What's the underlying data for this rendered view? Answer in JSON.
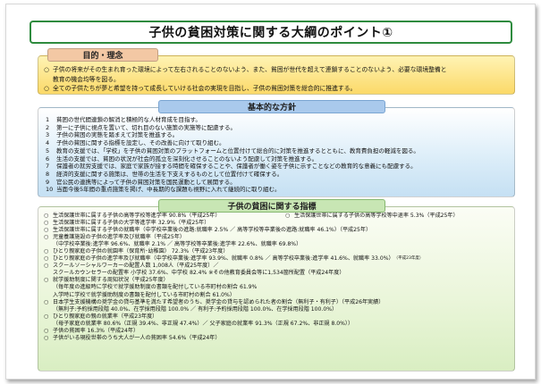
{
  "title": "子供の貧困対策に関する大綱のポイント①",
  "purpose": {
    "header": "目的・理念",
    "lines": [
      {
        "mark": "○",
        "text": "子供の将来がその生まれ育った環境によって左右されることのないよう、また、貧困が世代を超えて連鎖することのないよう、必要な環境整備と"
      },
      {
        "mark": "",
        "text": "教育の機会均等を図る。"
      },
      {
        "mark": "○",
        "text": "全ての子供たちが夢と希望を持って成長していける社会の実現を目指し、子供の貧困対策を総合的に推進する。"
      }
    ]
  },
  "policy": {
    "header": "基本的な方針",
    "items": [
      {
        "no": "1",
        "text": "貧困の世代間連鎖の解消と積極的な人材育成を目指す。"
      },
      {
        "no": "2",
        "text": "第一に子供に視点を置いて、切れ目のない施策の実施等に配慮する。"
      },
      {
        "no": "3",
        "text": "子供の貧困の実態を踏まえて対策を推進する。"
      },
      {
        "no": "4",
        "text": "子供の貧困に関する指標を設定し、その改善に向けて取り組む。"
      },
      {
        "no": "5",
        "text": "教育の支援では、「学校」を子供の貧困対策のプラットフォームと位置付けて総合的に対策を推進するとともに、教育費負担の軽減を図る。"
      },
      {
        "no": "6",
        "text": "生活の支援では、貧困の状況が社会的孤立を深刻化させることのないよう配慮して対策を推進する。"
      },
      {
        "no": "7",
        "text": "保護者の就労支援では、家庭で家族が接する時間を確保することや、保護者が働く姿を子供に示すことなどの教育的な意義にも配慮する。"
      },
      {
        "no": "8",
        "text": "経済的支援に関する施策は、世帯の生活を下支えするものとして位置付けて確保する。"
      },
      {
        "no": "9",
        "text": "官公民の連携等によって子供の貧困対策を国民運動として展開する。"
      },
      {
        "no": "10",
        "text": "当面今後5年間の重点施策を掲げ、中長期的な課題も視野に入れて継続的に取り組む。"
      }
    ]
  },
  "index": {
    "header": "子供の貧困に関する指標",
    "row1_left": "生活保護世帯に属する子供の高等学校等進学率 90.8%（平成25年）",
    "row1_right": "生活保護世帯に属する子供の高等学校等中退率 5.3%（平成25年）",
    "lines": [
      {
        "mark": "○",
        "text": "生活保護世帯に属する子供の大学等進学率 32.9%（平成25年）",
        "small": ""
      },
      {
        "mark": "○",
        "text": "生活保護世帯に属する子供の就職率（中学校卒業後の進路:就職率 2.5% ／ 高等学校等卒業後の進路:就職率 46.1%）（平成25年）",
        "small": ""
      },
      {
        "mark": "○",
        "text": "児童養護施設の子供の進学率及び就職率（平成25年）",
        "small": ""
      },
      {
        "mark": "",
        "text": "（中学校卒業後:進学率 96.6%、就職率 2.1% ／ 高等学校等卒業後:進学率 22.6%、就職率 69.8%）",
        "small": ""
      },
      {
        "mark": "○",
        "text": "ひとり親家庭の子供の就園率（保育所･幼稚園） 72.3%（平成23年度）",
        "small": ""
      },
      {
        "mark": "○",
        "text": "ひとり親家庭の子供の進学率及び就職率（中学校卒業後:進学率 93.9%、就職率 0.8% ／ 高等学校卒業後:進学率 41.6%、就職率 33.0%）",
        "small": "（平成23年度）"
      },
      {
        "mark": "○",
        "text": "スクールソーシャルワーカーの配置人数 1,008人（平成25年度）／",
        "small": ""
      },
      {
        "mark": "",
        "text": "スクールカウンセラーの配置率 小学校 37.6%、中学校 82.4% ※その他教育委員会等に1,534箇所配置（平成24年度）",
        "small": ""
      },
      {
        "mark": "○",
        "text": "就学援助制度に関する周知状況（平成25年度）",
        "small": ""
      },
      {
        "mark": "",
        "text": "（毎年度の進級時に学校で就学援助制度の書類を配付している市町村の割合 61.9%",
        "small": ""
      },
      {
        "mark": "",
        "text": "入学時に学校で就学援助制度の書類を配付している市町村の割合 61.0%）",
        "small": ""
      },
      {
        "mark": "○",
        "text": "日本学生支援機構の奨学金の貸与基準を満たす希望者のうち、奨学金の貸与を認められた者の割合（無利子・有利子）（平成26年実績）",
        "small": ""
      },
      {
        "mark": "",
        "text": "（無利子:予約採用段階 40.0%、在学採用段階 100.0% ／ 有利子:予約採用段階 100.0%、在学採用段階 100.0%）",
        "small": ""
      },
      {
        "mark": "○",
        "text": "ひとり親家庭の親の就業率（平成23年度）",
        "small": ""
      },
      {
        "mark": "",
        "text": "（母子家庭の就業率 80.6%（正規 39.4%、非正規 47.4%）／ 父子家庭の就業率 91.3%（正規 67.2%、非正規 8.0%））",
        "small": ""
      },
      {
        "mark": "○",
        "text": "子供の貧困率 16.3%（平成24年）",
        "small": ""
      },
      {
        "mark": "○",
        "text": "子供がいる現役世帯のうち大人が一人の貧困率 54.6%（平成24年）",
        "small": ""
      }
    ]
  }
}
